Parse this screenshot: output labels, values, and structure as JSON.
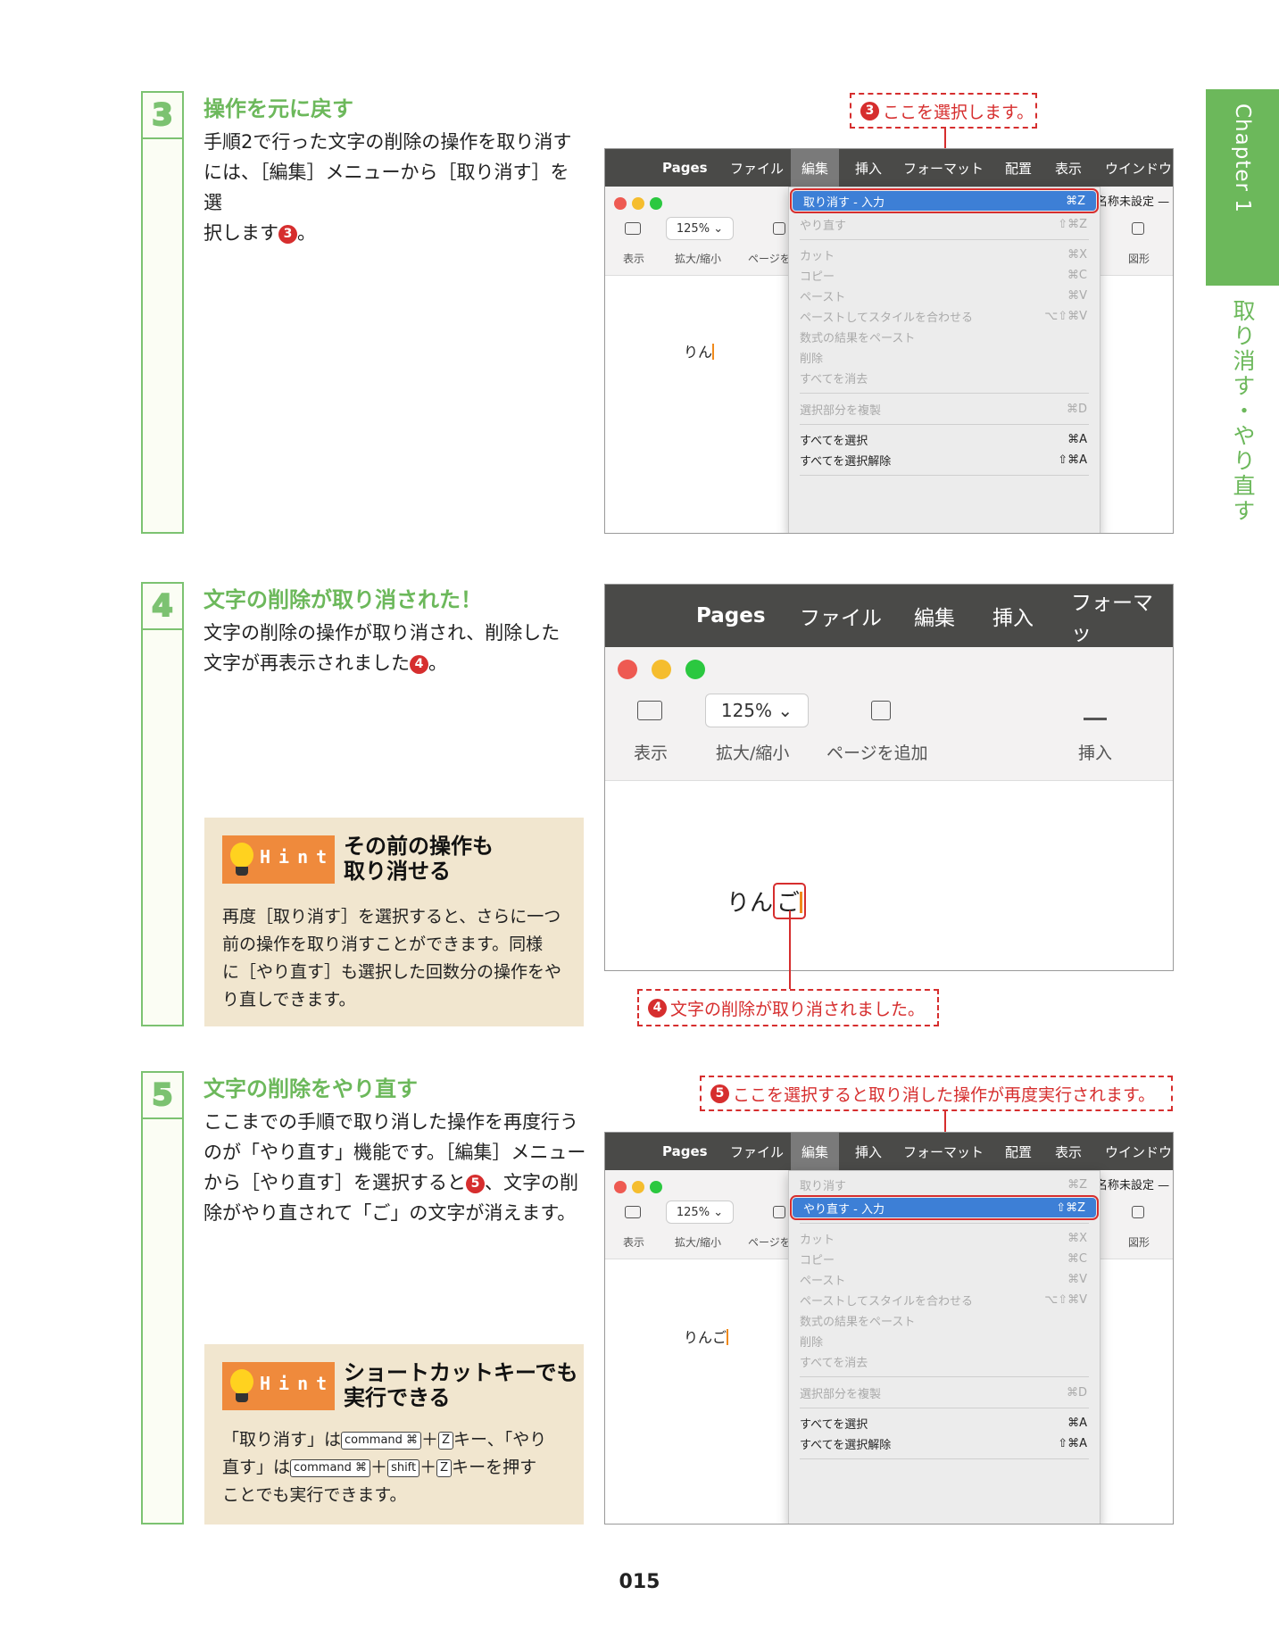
{
  "chapter": {
    "tab_label": "Chapter 1",
    "side_title": "取り消す・やり直す"
  },
  "page_number": "015",
  "steps": [
    {
      "number": "3",
      "title": "操作を元に戻す",
      "body_lines": [
        "手順2で行った文字の削除の操作を取り消す",
        "には、［編集］メニューから［取り消す］を選",
        "択します"
      ],
      "body_marker": "3",
      "body_tail": "。"
    },
    {
      "number": "4",
      "title": "文字の削除が取り消された！",
      "body_lines": [
        "文字の削除の操作が取り消され、削除した",
        "文字が再表示されました"
      ],
      "body_marker": "4",
      "body_tail": "。"
    },
    {
      "number": "5",
      "title": "文字の削除をやり直す",
      "body_lines": [
        "ここまでの手順で取り消した操作を再度行う",
        "のが「やり直す」機能です。［編集］メニュー",
        "から［やり直す］を選択すると",
        "除がやり直されて「ご」の文字が消えます。"
      ],
      "body_marker": "5",
      "body_mid": "、文字の削"
    }
  ],
  "hints": [
    {
      "badge": "Hint",
      "title_lines": [
        "その前の操作も",
        "取り消せる"
      ],
      "body_lines": [
        "再度［取り消す］を選択すると、さらに一つ",
        "前の操作を取り消すことができます。同様",
        "に［やり直す］も選択した回数分の操作をや",
        "り直しできます。"
      ]
    },
    {
      "badge": "Hint",
      "title_lines": [
        "ショートカットキーでも",
        "実行できる"
      ],
      "body_line1_a": "「取り消す」は",
      "body_line1_b": "キー、「やり",
      "body_line2_a": "直す」は",
      "body_line2_b": "キーを押す",
      "body_line3": "ことでも実行できます。",
      "key_command": "command ⌘",
      "key_z": "Z",
      "key_shift": "shift",
      "plus": "＋"
    }
  ],
  "screens": {
    "menubar_small": [
      "Pages",
      "ファイル",
      "編集",
      "挿入",
      "フォーマット",
      "配置",
      "表示",
      "ウインドウ"
    ],
    "menubar_large": [
      "Pages",
      "ファイル",
      "編集",
      "挿入",
      "フォーマッ"
    ],
    "toolbar_small": {
      "zoom": "125%",
      "view_label": "表示",
      "zoom_label": "拡大/縮小",
      "page_label": "ページを",
      "shape_label": "図形",
      "corner_text": "名称未設定 —"
    },
    "toolbar_large": {
      "zoom": "125%",
      "view_label": "表示",
      "zoom_label": "拡大/縮小",
      "add_page_label": "ページを追加",
      "insert_label": "挿入"
    },
    "doc_text_1": "りん",
    "doc_text_2_a": "りん",
    "doc_text_2_b": "ご",
    "doc_text_3": "りんご",
    "edit_menu_undo": [
      {
        "label": "取り消す - 入力",
        "shortcut": "⌘Z",
        "state": "highlighted"
      },
      {
        "label": "やり直す",
        "shortcut": "⇧⌘Z",
        "state": "disabled"
      },
      {
        "label": "カット",
        "shortcut": "⌘X",
        "state": "disabled"
      },
      {
        "label": "コピー",
        "shortcut": "⌘C",
        "state": "disabled"
      },
      {
        "label": "ペースト",
        "shortcut": "⌘V",
        "state": "disabled"
      },
      {
        "label": "ペーストしてスタイルを合わせる",
        "shortcut": "⌥⇧⌘V",
        "state": "disabled"
      },
      {
        "label": "数式の結果をペースト",
        "shortcut": "",
        "state": "disabled"
      },
      {
        "label": "削除",
        "shortcut": "",
        "state": "disabled"
      },
      {
        "label": "すべてを消去",
        "shortcut": "",
        "state": "disabled"
      },
      {
        "label": "選択部分を複製",
        "shortcut": "⌘D",
        "state": "disabled"
      },
      {
        "label": "すべてを選択",
        "shortcut": "⌘A",
        "state": "enabled"
      },
      {
        "label": "すべてを選択解除",
        "shortcut": "⇧⌘A",
        "state": "enabled"
      }
    ],
    "edit_menu_redo": [
      {
        "label": "取り消す",
        "shortcut": "⌘Z",
        "state": "disabled"
      },
      {
        "label": "やり直す - 入力",
        "shortcut": "⇧⌘Z",
        "state": "highlighted"
      },
      {
        "label": "カット",
        "shortcut": "⌘X",
        "state": "disabled"
      },
      {
        "label": "コピー",
        "shortcut": "⌘C",
        "state": "disabled"
      },
      {
        "label": "ペースト",
        "shortcut": "⌘V",
        "state": "disabled"
      },
      {
        "label": "ペーストしてスタイルを合わせる",
        "shortcut": "⌥⇧⌘V",
        "state": "disabled"
      },
      {
        "label": "数式の結果をペースト",
        "shortcut": "",
        "state": "disabled"
      },
      {
        "label": "削除",
        "shortcut": "",
        "state": "disabled"
      },
      {
        "label": "すべてを消去",
        "shortcut": "",
        "state": "disabled"
      },
      {
        "label": "選択部分を複製",
        "shortcut": "⌘D",
        "state": "disabled"
      },
      {
        "label": "すべてを選択",
        "shortcut": "⌘A",
        "state": "enabled"
      },
      {
        "label": "すべてを選択解除",
        "shortcut": "⇧⌘A",
        "state": "enabled"
      }
    ]
  },
  "callouts": [
    {
      "number": "3",
      "text": "ここを選択します。"
    },
    {
      "number": "4",
      "text": "文字の削除が取り消されました。"
    },
    {
      "number": "5",
      "text": "ここを選択すると取り消した操作が再度実行されます。"
    }
  ],
  "colors": {
    "accent_green": "#6cb85b",
    "callout_red": "#d62e2e",
    "menu_highlight": "#3d7fd6",
    "hint_bg": "#f1e6cf",
    "hint_badge": "#ef8a3c"
  }
}
